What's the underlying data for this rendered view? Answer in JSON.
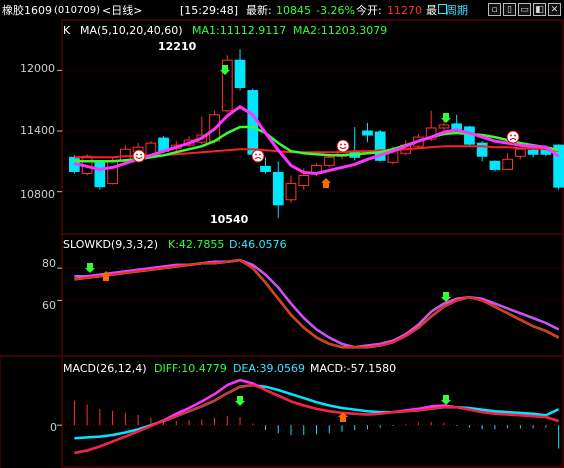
{
  "colors": {
    "up": "#ff3232",
    "down": "#00e6ff",
    "ma5": "#ff33ff",
    "ma10": "#33ff33",
    "ma20": "#ff2020",
    "grid": "#7a0000",
    "axis_text": "#cccccc",
    "label_green": "#33ff33",
    "label_cyan": "#33e6ff",
    "label_white": "#ffffff",
    "price_red": "#ff3232"
  },
  "header": {
    "symbol": "橡胶1609",
    "code": "(010709)",
    "period": "<日线>",
    "time": "[15:29:48]",
    "last_label": "最新:",
    "last_value": "10845",
    "change_pct": "-3.26%",
    "open_label": "今开:",
    "open_value": "11270",
    "cut_text": "最",
    "cycle_label": "周期",
    "cycle_icon": "calendar-icon",
    "window_buttons": [
      "▫",
      "▯",
      "▭",
      "◧",
      "✕"
    ]
  },
  "price_panel": {
    "indicator": "K",
    "ma_params": "MA(5,10,20,40,60)",
    "ma1_label": "MA1:11112.9117",
    "ma2_label": "MA2:11203.3079",
    "y_ticks": [
      "12000",
      "11400",
      "10800"
    ],
    "high_marker": "12210",
    "low_marker": "10540"
  },
  "kd_panel": {
    "name": "SLOWKD(9,3,3,2)",
    "k_label": "K:42.7855",
    "d_label": "D:46.0576",
    "y_ticks": [
      "80",
      "60"
    ]
  },
  "macd_panel": {
    "name": "MACD(26,12,4)",
    "diff_label": "DIFF:10.4779",
    "dea_label": "DEA:39.0569",
    "macd_label": "MACD:-57.1580",
    "y_ticks": [
      "0"
    ]
  },
  "chart_data": {
    "type": "candlestick",
    "title": "",
    "candles": [
      {
        "o": 11140,
        "c": 11000,
        "h": 11160,
        "l": 10980
      },
      {
        "o": 10980,
        "c": 11150,
        "h": 11170,
        "l": 10960
      },
      {
        "o": 11100,
        "c": 10850,
        "h": 11110,
        "l": 10820
      },
      {
        "o": 10880,
        "c": 11100,
        "h": 11140,
        "l": 10870
      },
      {
        "o": 11100,
        "c": 11220,
        "h": 11260,
        "l": 11080
      },
      {
        "o": 11200,
        "c": 11240,
        "h": 11280,
        "l": 11180
      },
      {
        "o": 11160,
        "c": 11280,
        "h": 11300,
        "l": 11140
      },
      {
        "o": 11330,
        "c": 11200,
        "h": 11350,
        "l": 11180
      },
      {
        "o": 11230,
        "c": 11260,
        "h": 11300,
        "l": 11200
      },
      {
        "o": 11260,
        "c": 11310,
        "h": 11350,
        "l": 11240
      },
      {
        "o": 11290,
        "c": 11360,
        "h": 11540,
        "l": 11270
      },
      {
        "o": 11300,
        "c": 11560,
        "h": 11600,
        "l": 11280
      },
      {
        "o": 11600,
        "c": 12100,
        "h": 12150,
        "l": 11580
      },
      {
        "o": 12100,
        "c": 11830,
        "h": 12210,
        "l": 11800
      },
      {
        "o": 11800,
        "c": 11170,
        "h": 11820,
        "l": 11150
      },
      {
        "o": 11050,
        "c": 11000,
        "h": 11140,
        "l": 10980
      },
      {
        "o": 10990,
        "c": 10670,
        "h": 11100,
        "l": 10540
      },
      {
        "o": 10720,
        "c": 10880,
        "h": 10960,
        "l": 10690
      },
      {
        "o": 10860,
        "c": 10960,
        "h": 11030,
        "l": 10820
      },
      {
        "o": 10980,
        "c": 11060,
        "h": 11080,
        "l": 10950
      },
      {
        "o": 11060,
        "c": 11140,
        "h": 11160,
        "l": 11040
      },
      {
        "o": 11150,
        "c": 11200,
        "h": 11300,
        "l": 11120
      },
      {
        "o": 11200,
        "c": 11140,
        "h": 11440,
        "l": 11110
      },
      {
        "o": 11400,
        "c": 11360,
        "h": 11480,
        "l": 11290
      },
      {
        "o": 11390,
        "c": 11110,
        "h": 11410,
        "l": 11100
      },
      {
        "o": 11090,
        "c": 11220,
        "h": 11250,
        "l": 11070
      },
      {
        "o": 11180,
        "c": 11260,
        "h": 11310,
        "l": 11160
      },
      {
        "o": 11250,
        "c": 11340,
        "h": 11370,
        "l": 11230
      },
      {
        "o": 11320,
        "c": 11430,
        "h": 11600,
        "l": 11300
      },
      {
        "o": 11430,
        "c": 11460,
        "h": 11580,
        "l": 11410
      },
      {
        "o": 11470,
        "c": 11420,
        "h": 11560,
        "l": 11380
      },
      {
        "o": 11440,
        "c": 11270,
        "h": 11450,
        "l": 11250
      },
      {
        "o": 11280,
        "c": 11150,
        "h": 11300,
        "l": 11100
      },
      {
        "o": 11100,
        "c": 11020,
        "h": 11110,
        "l": 11000
      },
      {
        "o": 11020,
        "c": 11120,
        "h": 11180,
        "l": 11010
      },
      {
        "o": 11150,
        "c": 11220,
        "h": 11240,
        "l": 11120
      },
      {
        "o": 11210,
        "c": 11170,
        "h": 11260,
        "l": 11140
      },
      {
        "o": 11230,
        "c": 11170,
        "h": 11260,
        "l": 11150
      },
      {
        "o": 11260,
        "c": 10845,
        "h": 11270,
        "l": 10820
      }
    ],
    "ma5": [
      11080,
      11050,
      11020,
      11040,
      11080,
      11120,
      11160,
      11200,
      11240,
      11280,
      11330,
      11420,
      11550,
      11640,
      11560,
      11380,
      11210,
      11060,
      10990,
      10980,
      11010,
      11040,
      11070,
      11120,
      11160,
      11200,
      11250,
      11300,
      11340,
      11390,
      11410,
      11380,
      11340,
      11300,
      11280,
      11260,
      11250,
      11240,
      11150
    ],
    "ma10": [
      11100,
      11100,
      11100,
      11100,
      11110,
      11120,
      11140,
      11160,
      11190,
      11220,
      11250,
      11300,
      11380,
      11440,
      11440,
      11380,
      11280,
      11200,
      11180,
      11170,
      11160,
      11160,
      11170,
      11180,
      11190,
      11220,
      11260,
      11300,
      11340,
      11370,
      11380,
      11370,
      11360,
      11340,
      11310,
      11280,
      11260,
      11240,
      11210
    ],
    "ma20": [
      11140,
      11140,
      11140,
      11140,
      11150,
      11150,
      11160,
      11160,
      11170,
      11180,
      11190,
      11200,
      11210,
      11220,
      11220,
      11210,
      11200,
      11190,
      11190,
      11190,
      11190,
      11190,
      11200,
      11200,
      11210,
      11210,
      11220,
      11230,
      11240,
      11250,
      11250,
      11250,
      11250,
      11240,
      11240,
      11230,
      11230,
      11220,
      11203
    ],
    "kd_k": [
      73,
      74,
      75,
      76,
      77,
      78,
      79,
      80,
      81,
      82,
      83,
      83,
      84,
      85,
      80,
      71,
      61,
      51,
      43,
      37,
      33,
      31,
      31,
      32,
      33,
      35,
      39,
      45,
      53,
      58,
      61,
      62,
      60,
      56,
      52,
      48,
      44,
      41,
      37
    ],
    "kd_d": [
      75,
      75,
      76,
      77,
      78,
      79,
      80,
      81,
      82,
      82,
      83,
      84,
      84,
      85,
      82,
      76,
      68,
      58,
      49,
      42,
      37,
      33,
      31,
      31,
      32,
      34,
      38,
      43,
      50,
      56,
      60,
      62,
      61,
      58,
      55,
      52,
      49,
      46,
      42
    ],
    "macd_diff": [
      -68,
      -62,
      -52,
      -40,
      -28,
      -15,
      -2,
      12,
      28,
      42,
      58,
      76,
      98,
      110,
      102,
      86,
      72,
      58,
      48,
      40,
      34,
      30,
      28,
      26,
      28,
      32,
      36,
      40,
      46,
      48,
      44,
      38,
      32,
      28,
      26,
      24,
      22,
      20,
      10
    ],
    "macd_dea": [
      -32,
      -30,
      -28,
      -24,
      -18,
      -10,
      0,
      10,
      22,
      34,
      46,
      60,
      78,
      94,
      98,
      94,
      86,
      76,
      66,
      56,
      48,
      42,
      38,
      34,
      32,
      32,
      34,
      36,
      40,
      44,
      44,
      42,
      38,
      34,
      32,
      30,
      28,
      24,
      39
    ],
    "macd_bar": [
      60,
      50,
      40,
      35,
      30,
      25,
      18,
      12,
      10,
      12,
      14,
      18,
      22,
      20,
      4,
      -12,
      -20,
      -24,
      -24,
      -22,
      -20,
      -16,
      -12,
      -10,
      -6,
      -2,
      2,
      6,
      8,
      6,
      -2,
      -6,
      -10,
      -10,
      -8,
      -8,
      -8,
      -6,
      -57
    ],
    "price_ylim": [
      10500,
      12300
    ],
    "kd_ylim": [
      28,
      90
    ],
    "macd_ylim": [
      -90,
      125
    ]
  }
}
